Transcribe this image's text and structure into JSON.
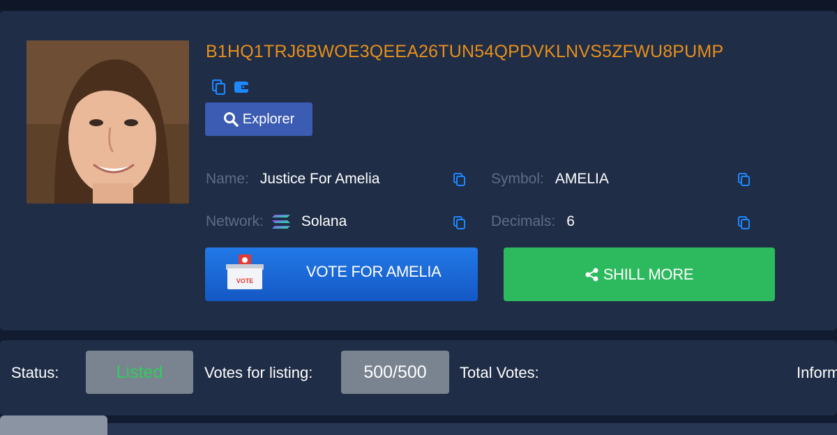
{
  "token": {
    "address": "B1HQ1TRJ6BWOE3QEEA26TUN54QPDVKLNVS5ZFWU8PUMP",
    "explorer_label": "Explorer"
  },
  "fields": {
    "name_label": "Name:",
    "name_value": "Justice For Amelia",
    "symbol_label": "Symbol:",
    "symbol_value": "AMELIA",
    "network_label": "Network:",
    "network_value": "Solana",
    "decimals_label": "Decimals:",
    "decimals_value": "6"
  },
  "actions": {
    "vote_label": "VOTE FOR AMELIA",
    "vote_box_text": "VOTE",
    "shill_label": "SHILL MORE"
  },
  "status": {
    "status_label": "Status:",
    "status_value": "Listed",
    "votes_label": "Votes for listing:",
    "votes_value": "500/500",
    "total_votes_label": "Total Votes:",
    "info_label": "Inform"
  },
  "colors": {
    "background": "#121c30",
    "card": "#1f2d47",
    "address": "#e88f1a",
    "vote_button": "#1b6cdc",
    "shill_button": "#2dba5e",
    "listed": "#2fcf5a",
    "icon_blue": "#1e88ff"
  },
  "icons": [
    "copy-icon",
    "wallet-icon",
    "search-icon",
    "solana-icon",
    "ballot-box-icon",
    "share-icon"
  ]
}
